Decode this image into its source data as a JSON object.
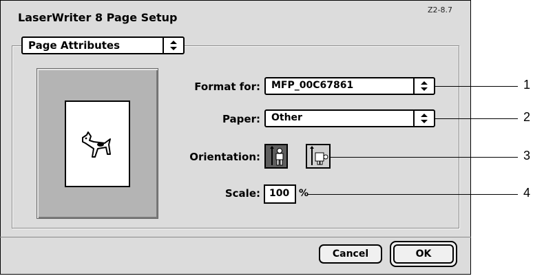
{
  "dialog": {
    "title": "LaserWriter 8 Page Setup",
    "version": "Z2-8.7",
    "section_popup": "Page Attributes",
    "format_for": {
      "label": "Format for:",
      "value": "MFP_00C67861"
    },
    "paper": {
      "label": "Paper:",
      "value": "Other"
    },
    "orientation": {
      "label": "Orientation:",
      "selected": "portrait",
      "options": [
        "portrait-icon",
        "landscape-icon"
      ]
    },
    "scale": {
      "label": "Scale:",
      "value": "100",
      "unit": "%"
    },
    "buttons": {
      "cancel": "Cancel",
      "ok": "OK"
    }
  },
  "callouts": [
    "1",
    "2",
    "3",
    "4"
  ]
}
